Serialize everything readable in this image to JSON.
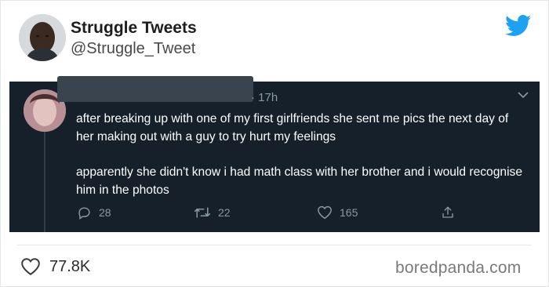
{
  "card": {
    "display_name": "Struggle Tweets",
    "handle": "@Struggle_Tweet",
    "likes": "77.8K",
    "source_brand": "boredpanda.com"
  },
  "embedded_tweet": {
    "timestamp": "· 17h",
    "paragraphs": [
      "after breaking up with one of my first girlfriends she sent me pics the next day of her making out with a guy to try hurt my feelings",
      "apparently she didn't know i had math class with her brother and i would recognise him in the photos"
    ],
    "replies": "28",
    "retweets": "22",
    "likes": "165"
  },
  "colors": {
    "twitter_blue": "#1da1f2",
    "embed_bg": "#15202b",
    "embed_muted": "#8899a6"
  },
  "icons": [
    "twitter-bird-icon",
    "chevron-down-icon",
    "reply-icon",
    "retweet-icon",
    "like-icon",
    "share-icon",
    "heart-outline-icon"
  ]
}
